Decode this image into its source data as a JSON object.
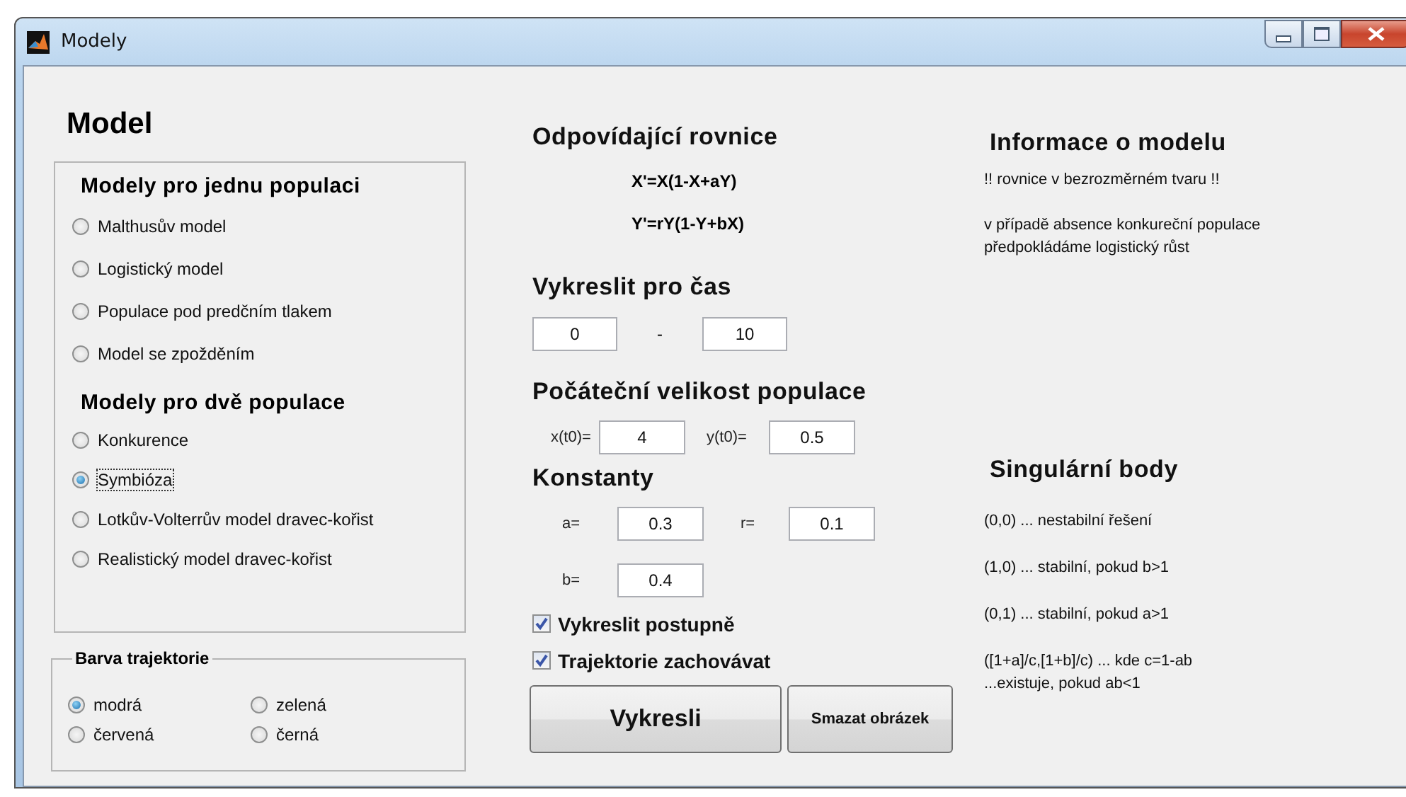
{
  "window": {
    "title": "Modely"
  },
  "model": {
    "title": "Model",
    "groups": [
      {
        "title": "Modely pro jednu populaci",
        "options": [
          {
            "label": "Malthusův model",
            "selected": false,
            "focused": false
          },
          {
            "label": "Logistický model",
            "selected": false,
            "focused": false
          },
          {
            "label": "Populace pod predčním tlakem",
            "selected": false,
            "focused": false
          },
          {
            "label": "Model se zpožděním",
            "selected": false,
            "focused": false
          }
        ]
      },
      {
        "title": "Modely pro dvě populace",
        "options": [
          {
            "label": "Konkurence",
            "selected": false,
            "focused": false
          },
          {
            "label": "Symbióza",
            "selected": true,
            "focused": true
          },
          {
            "label": "Lotkův-Volterrův model dravec-kořist",
            "selected": false,
            "focused": false
          },
          {
            "label": "Realistický model dravec-kořist",
            "selected": false,
            "focused": false
          }
        ]
      }
    ]
  },
  "trajectory_color": {
    "title": "Barva trajektorie",
    "options": [
      {
        "label": "modrá",
        "selected": true
      },
      {
        "label": "zelená",
        "selected": false
      },
      {
        "label": "červená",
        "selected": false
      },
      {
        "label": "černá",
        "selected": false
      }
    ]
  },
  "equations": {
    "title": "Odpovídající rovnice",
    "lines": [
      "X'=X(1-X+aY)",
      "Y'=rY(1-Y+bX)"
    ]
  },
  "time": {
    "title": "Vykreslit pro čas",
    "from": "0",
    "separator": "-",
    "to": "10"
  },
  "initial": {
    "title": "Počáteční velikost populace",
    "fields": [
      {
        "label": "x(t0)=",
        "value": "4"
      },
      {
        "label": "y(t0)=",
        "value": "0.5"
      }
    ]
  },
  "constants": {
    "title": "Konstanty",
    "rows": [
      [
        {
          "label": "a=",
          "value": "0.3"
        },
        {
          "label": "r=",
          "value": "0.1"
        }
      ],
      [
        {
          "label": "b=",
          "value": "0.4"
        }
      ]
    ]
  },
  "checkboxes": [
    {
      "label": "Vykreslit postupně",
      "checked": true
    },
    {
      "label": "Trajektorie zachovávat",
      "checked": true
    }
  ],
  "buttons": [
    {
      "label": "Vykresli",
      "kind": "primary"
    },
    {
      "label": "Smazat obrázek",
      "kind": "secondary"
    }
  ],
  "info": {
    "title": "Informace o modelu",
    "paragraphs": [
      [
        "!! rovnice v bezrozměrném tvaru !!"
      ],
      [
        "v případě absence konkureční populace",
        "předpokládáme logistický růst"
      ]
    ]
  },
  "singular": {
    "title": "Singulární body",
    "paragraphs": [
      [
        "(0,0) ... nestabilní řešení"
      ],
      [
        "(1,0) ... stabilní, pokud b>1"
      ],
      [
        "(0,1) ... stabilní, pokud a>1"
      ],
      [
        "([1+a]/c,[1+b]/c) ... kde c=1-ab",
        "...existuje, pokud ab<1"
      ]
    ]
  }
}
